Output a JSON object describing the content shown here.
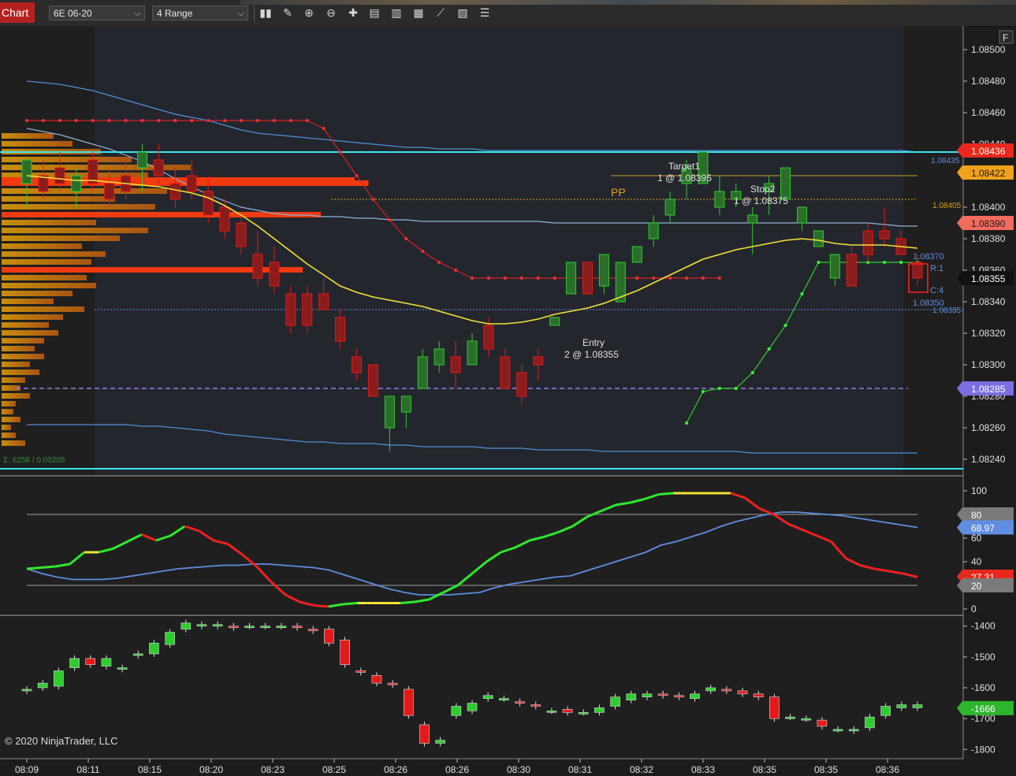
{
  "toolbar": {
    "tab_label": "Chart",
    "instrument": "6E 06-20",
    "bar_type": "4 Range",
    "icons": [
      "bar-type-icon",
      "draw-pencil-icon",
      "zoom-in-icon",
      "zoom-out-icon",
      "crosshair-icon",
      "properties-icon",
      "chart-trader-icon",
      "indicators-icon",
      "strategies-icon",
      "data-box-icon",
      "object-list-icon"
    ]
  },
  "price_panel": {
    "y_ticks": [
      "1.08500",
      "1.08480",
      "1.08460",
      "1.08440",
      "1.08420",
      "1.08400",
      "1.08380",
      "1.08360",
      "1.08340",
      "1.08320",
      "1.08300",
      "1.08280",
      "1.08260",
      "1.08240"
    ],
    "flags": [
      {
        "text": "1.08436",
        "bg": "#e8281c",
        "fg": "#ffffff"
      },
      {
        "text": "1.08422",
        "bg": "#f0a21c",
        "fg": "#1a1a1a"
      },
      {
        "text": "1.08390",
        "bg": "#f26b5e",
        "fg": "#1a1a1a"
      },
      {
        "text": "1.08355",
        "bg": "#111111",
        "fg": "#ffffff"
      },
      {
        "text": "1.08285",
        "bg": "#7b6fe0",
        "fg": "#ffffff"
      }
    ],
    "line_labels": {
      "cyan_level": "1.08435",
      "pp_level": "1.08405",
      "orders_upper": "1.08370",
      "orders_lower": "1.08350",
      "blue_level": "1.08335"
    },
    "pp_label": "PP",
    "orders": {
      "r": "R:1",
      "c": "C:4"
    },
    "annotations": {
      "target_title": "Target1",
      "target_detail": "1 @ 1.08395",
      "stop_title": "Stop2",
      "stop_detail": "1 @ 1.08375",
      "entry_title": "Entry",
      "entry_detail": "2 @ 1.08355"
    },
    "profile_summary": "Σ: 6258 / 0.00205",
    "f_button": "F"
  },
  "oscillator_panel": {
    "y_ticks": [
      "100",
      "80",
      "60",
      "40",
      "20",
      "0"
    ],
    "flags": [
      {
        "text": "80",
        "bg": "#7a7a7a",
        "fg": "#ffffff"
      },
      {
        "text": "68.97",
        "bg": "#5f8de0",
        "fg": "#ffffff"
      },
      {
        "text": "27.31",
        "bg": "#e8281c",
        "fg": "#ffffff"
      },
      {
        "text": "20",
        "bg": "#7a7a7a",
        "fg": "#ffffff"
      }
    ]
  },
  "delta_panel": {
    "y_ticks": [
      "-1400",
      "-1500",
      "-1600",
      "-1700",
      "-1800"
    ],
    "flags": [
      {
        "text": "-1666",
        "bg": "#2db52d",
        "fg": "#ffffff"
      }
    ]
  },
  "x_axis": {
    "ticks": [
      "08:09",
      "08:11",
      "08:15",
      "08:20",
      "08:23",
      "08:25",
      "08:26",
      "08:26",
      "08:30",
      "08:31",
      "08:32",
      "08:33",
      "08:35",
      "08:35",
      "08:36"
    ]
  },
  "copyright": "© 2020 NinjaTrader, LLC",
  "colors": {
    "up": "#2ecc2e",
    "down": "#e31a1a",
    "up_bright": "#19ff19",
    "down_bright": "#ff1a1a",
    "cyan": "#39e6f2",
    "pp": "#d9a21b",
    "poc": "#f03a10",
    "panel_bg": "#1e1e1e"
  },
  "chart_data": {
    "type": "candlestick",
    "price": {
      "candles": [
        {
          "o": 1.08415,
          "h": 1.08425,
          "l": 1.084,
          "c": 1.0843
        },
        {
          "o": 1.0842,
          "h": 1.0843,
          "l": 1.08405,
          "c": 1.0841
        },
        {
          "o": 1.08425,
          "h": 1.08435,
          "l": 1.0841,
          "c": 1.08415
        },
        {
          "o": 1.0841,
          "h": 1.08425,
          "l": 1.084,
          "c": 1.0842
        },
        {
          "o": 1.0843,
          "h": 1.08435,
          "l": 1.0841,
          "c": 1.08415
        },
        {
          "o": 1.08415,
          "h": 1.08425,
          "l": 1.084,
          "c": 1.08405
        },
        {
          "o": 1.0842,
          "h": 1.0843,
          "l": 1.08405,
          "c": 1.0841
        },
        {
          "o": 1.08425,
          "h": 1.0844,
          "l": 1.0841,
          "c": 1.08435
        },
        {
          "o": 1.0843,
          "h": 1.0844,
          "l": 1.08415,
          "c": 1.0842
        },
        {
          "o": 1.08415,
          "h": 1.08425,
          "l": 1.084,
          "c": 1.08405
        },
        {
          "o": 1.0842,
          "h": 1.0843,
          "l": 1.08405,
          "c": 1.0841
        },
        {
          "o": 1.0841,
          "h": 1.0842,
          "l": 1.0839,
          "c": 1.08395
        },
        {
          "o": 1.084,
          "h": 1.08405,
          "l": 1.0838,
          "c": 1.08385
        },
        {
          "o": 1.0839,
          "h": 1.08395,
          "l": 1.0837,
          "c": 1.08375
        },
        {
          "o": 1.0837,
          "h": 1.08385,
          "l": 1.0835,
          "c": 1.08355
        },
        {
          "o": 1.08365,
          "h": 1.08375,
          "l": 1.08345,
          "c": 1.0835
        },
        {
          "o": 1.08345,
          "h": 1.0835,
          "l": 1.0832,
          "c": 1.08325
        },
        {
          "o": 1.08345,
          "h": 1.0835,
          "l": 1.0832,
          "c": 1.08325
        },
        {
          "o": 1.08345,
          "h": 1.08355,
          "l": 1.08335,
          "c": 1.08335
        },
        {
          "o": 1.0833,
          "h": 1.08335,
          "l": 1.0831,
          "c": 1.08315
        },
        {
          "o": 1.08305,
          "h": 1.0831,
          "l": 1.0829,
          "c": 1.08295
        },
        {
          "o": 1.083,
          "h": 1.083,
          "l": 1.0828,
          "c": 1.0828
        },
        {
          "o": 1.0826,
          "h": 1.08265,
          "l": 1.08245,
          "c": 1.0828
        },
        {
          "o": 1.0827,
          "h": 1.08275,
          "l": 1.0826,
          "c": 1.0828
        },
        {
          "o": 1.08285,
          "h": 1.0831,
          "l": 1.08285,
          "c": 1.08305
        },
        {
          "o": 1.083,
          "h": 1.08315,
          "l": 1.08295,
          "c": 1.0831
        },
        {
          "o": 1.08305,
          "h": 1.08315,
          "l": 1.08285,
          "c": 1.08295
        },
        {
          "o": 1.083,
          "h": 1.0832,
          "l": 1.083,
          "c": 1.08315
        },
        {
          "o": 1.08325,
          "h": 1.0833,
          "l": 1.08305,
          "c": 1.0831
        },
        {
          "o": 1.08305,
          "h": 1.0831,
          "l": 1.08285,
          "c": 1.08285
        },
        {
          "o": 1.08295,
          "h": 1.083,
          "l": 1.08275,
          "c": 1.0828
        },
        {
          "o": 1.08305,
          "h": 1.0831,
          "l": 1.0829,
          "c": 1.083
        },
        {
          "o": 1.08325,
          "h": 1.0833,
          "l": 1.08325,
          "c": 1.0833
        },
        {
          "o": 1.08345,
          "h": 1.08365,
          "l": 1.08345,
          "c": 1.08365
        },
        {
          "o": 1.08365,
          "h": 1.08365,
          "l": 1.08345,
          "c": 1.08345
        },
        {
          "o": 1.0835,
          "h": 1.0837,
          "l": 1.08345,
          "c": 1.0837
        },
        {
          "o": 1.0834,
          "h": 1.08365,
          "l": 1.0834,
          "c": 1.08365
        },
        {
          "o": 1.08365,
          "h": 1.08375,
          "l": 1.08365,
          "c": 1.08375
        },
        {
          "o": 1.0838,
          "h": 1.08395,
          "l": 1.08375,
          "c": 1.0839
        },
        {
          "o": 1.08395,
          "h": 1.0841,
          "l": 1.0839,
          "c": 1.08405
        },
        {
          "o": 1.08415,
          "h": 1.0843,
          "l": 1.08405,
          "c": 1.08425
        },
        {
          "o": 1.08415,
          "h": 1.08435,
          "l": 1.08415,
          "c": 1.08435
        },
        {
          "o": 1.084,
          "h": 1.0842,
          "l": 1.08395,
          "c": 1.0841
        },
        {
          "o": 1.08405,
          "h": 1.08415,
          "l": 1.084,
          "c": 1.0841
        },
        {
          "o": 1.0839,
          "h": 1.084,
          "l": 1.0837,
          "c": 1.08395
        },
        {
          "o": 1.0841,
          "h": 1.0842,
          "l": 1.08395,
          "c": 1.08415
        },
        {
          "o": 1.08405,
          "h": 1.08425,
          "l": 1.08405,
          "c": 1.08425
        },
        {
          "o": 1.0839,
          "h": 1.084,
          "l": 1.08385,
          "c": 1.084
        },
        {
          "o": 1.08375,
          "h": 1.08385,
          "l": 1.08375,
          "c": 1.08385
        },
        {
          "o": 1.08355,
          "h": 1.0837,
          "l": 1.0835,
          "c": 1.0837
        },
        {
          "o": 1.0837,
          "h": 1.08375,
          "l": 1.0835,
          "c": 1.0835
        },
        {
          "o": 1.08385,
          "h": 1.0839,
          "l": 1.08365,
          "c": 1.0837
        },
        {
          "o": 1.08385,
          "h": 1.084,
          "l": 1.08375,
          "c": 1.0838
        },
        {
          "o": 1.0838,
          "h": 1.08385,
          "l": 1.0837,
          "c": 1.0837
        },
        {
          "o": 1.08365,
          "h": 1.0837,
          "l": 1.0835,
          "c": 1.08355
        }
      ],
      "ema": [
        1.0842,
        1.08419,
        1.08418,
        1.08417,
        1.08417,
        1.08416,
        1.08415,
        1.08414,
        1.08413,
        1.08411,
        1.08409,
        1.08406,
        1.08401,
        1.08395,
        1.08388,
        1.0838,
        1.08372,
        1.08364,
        1.08357,
        1.0835,
        1.08346,
        1.08343,
        1.08341,
        1.08339,
        1.08337,
        1.08334,
        1.08331,
        1.08328,
        1.08326,
        1.08326,
        1.08327,
        1.08329,
        1.08332,
        1.08334,
        1.08336,
        1.08339,
        1.08343,
        1.08347,
        1.08352,
        1.08357,
        1.08362,
        1.08367,
        1.0837,
        1.08373,
        1.08375,
        1.08377,
        1.08379,
        1.0838,
        1.08379,
        1.08377,
        1.08376,
        1.08376,
        1.08376,
        1.08375,
        1.08374
      ],
      "band_upper": [
        1.0848,
        1.08479,
        1.08478,
        1.08476,
        1.08474,
        1.08471,
        1.08468,
        1.08465,
        1.08462,
        1.08459,
        1.08457,
        1.08455,
        1.08452,
        1.08449,
        1.08447,
        1.08446,
        1.08445,
        1.08444,
        1.08443,
        1.08442,
        1.08441,
        1.0844,
        1.08439,
        1.08438,
        1.08438,
        1.08437,
        1.08437,
        1.08437,
        1.08436,
        1.08436,
        1.08436,
        1.08436,
        1.08436,
        1.08436,
        1.08436,
        1.08436,
        1.08436,
        1.08436,
        1.08436,
        1.08436,
        1.08436,
        1.08436,
        1.08436,
        1.08436,
        1.08436,
        1.08436,
        1.08436,
        1.08436,
        1.08436,
        1.08436,
        1.08436,
        1.08436,
        1.08436,
        1.08436,
        1.08435
      ],
      "band_mid": [
        1.0845,
        1.08448,
        1.08446,
        1.08443,
        1.0844,
        1.08437,
        1.08433,
        1.08429,
        1.08424,
        1.08418,
        1.08413,
        1.08408,
        1.08404,
        1.084,
        1.08398,
        1.08396,
        1.08395,
        1.08395,
        1.08394,
        1.08394,
        1.08393,
        1.08393,
        1.08392,
        1.08392,
        1.08391,
        1.08391,
        1.08391,
        1.08391,
        1.08391,
        1.08391,
        1.08391,
        1.08391,
        1.0839,
        1.0839,
        1.0839,
        1.0839,
        1.0839,
        1.0839,
        1.0839,
        1.0839,
        1.0839,
        1.0839,
        1.0839,
        1.0839,
        1.0839,
        1.0839,
        1.0839,
        1.0839,
        1.0839,
        1.0839,
        1.0839,
        1.0839,
        1.08389,
        1.08388,
        1.08388
      ],
      "band_lower": [
        1.08262,
        1.08262,
        1.08262,
        1.08262,
        1.08262,
        1.08262,
        1.08262,
        1.08261,
        1.08261,
        1.0826,
        1.08259,
        1.08258,
        1.08256,
        1.08255,
        1.08254,
        1.08253,
        1.08252,
        1.08251,
        1.08251,
        1.0825,
        1.0825,
        1.0825,
        1.08249,
        1.08249,
        1.08248,
        1.08248,
        1.08248,
        1.08248,
        1.08247,
        1.08247,
        1.08247,
        1.08246,
        1.08246,
        1.08246,
        1.08246,
        1.08245,
        1.08245,
        1.08245,
        1.08245,
        1.08245,
        1.08245,
        1.08245,
        1.08245,
        1.08245,
        1.08244,
        1.08244,
        1.08244,
        1.08244,
        1.08244,
        1.08244,
        1.08244,
        1.08244,
        1.08244,
        1.08244,
        1.08244
      ],
      "trail_red": [
        1.08455,
        1.08455,
        1.08455,
        1.08455,
        1.08455,
        1.08455,
        1.08455,
        1.08455,
        1.08455,
        1.08455,
        1.08455,
        1.08455,
        1.08455,
        1.08455,
        1.08455,
        1.08455,
        1.08455,
        1.08455,
        1.0845,
        1.08435,
        1.0842,
        1.08405,
        1.08392,
        1.0838,
        1.08372,
        1.08365,
        1.0836,
        1.08355,
        1.08355,
        1.08355,
        1.08355,
        1.08355,
        1.08355,
        1.08355,
        1.08355,
        1.08355,
        1.08355,
        1.08355,
        1.08355,
        1.08355,
        1.08355,
        1.08355,
        1.08355
      ],
      "trail_green_start": 40,
      "trail_green": [
        1.08263,
        1.08283,
        1.08285,
        1.08285,
        1.08295,
        1.0831,
        1.08325,
        1.08345,
        1.08365,
        1.08365,
        1.08365,
        1.08365,
        1.08365,
        1.08365,
        1.08365
      ],
      "levels": {
        "cyan_top": 1.08435,
        "cyan_bottom": 1.08234,
        "pp": 1.08405,
        "orders_gold": 1.0842,
        "red_stop": 1.08422,
        "blue_dotted": 1.08335,
        "purple_dashed": 1.08285
      },
      "y_range": [
        1.0823,
        1.08515
      ]
    },
    "oscillator": {
      "fast": [
        34,
        35,
        36,
        38,
        48,
        48,
        51,
        57,
        63,
        58,
        62,
        70,
        66,
        58,
        55,
        46,
        36,
        23,
        12,
        6,
        3,
        2,
        4,
        5,
        5,
        5,
        5,
        6,
        8,
        14,
        20,
        30,
        40,
        48,
        52,
        58,
        61,
        65,
        70,
        78,
        83,
        88,
        90,
        93,
        97,
        98,
        98,
        98,
        98,
        98,
        94,
        85,
        80,
        72,
        67,
        62,
        57,
        43,
        37,
        34,
        32,
        30,
        27
      ],
      "slow": [
        34,
        30,
        27,
        25,
        25,
        25,
        26,
        28,
        30,
        32,
        34,
        35,
        36,
        37,
        37,
        38,
        38,
        37,
        36,
        35,
        33,
        29,
        25,
        21,
        17,
        14,
        12,
        12,
        12,
        13,
        14,
        18,
        21,
        23,
        25,
        27,
        28,
        32,
        36,
        40,
        44,
        48,
        54,
        57,
        61,
        65,
        70,
        74,
        77,
        80,
        82,
        82,
        81,
        80,
        79,
        77,
        75,
        73,
        71,
        69
      ]
    },
    "delta": {
      "bars": [
        {
          "o": -1610,
          "c": -1605
        },
        {
          "o": -1600,
          "c": -1585
        },
        {
          "o": -1595,
          "c": -1545
        },
        {
          "o": -1535,
          "c": -1505
        },
        {
          "o": -1505,
          "c": -1525
        },
        {
          "o": -1530,
          "c": -1505
        },
        {
          "o": -1540,
          "c": -1535
        },
        {
          "o": -1495,
          "c": -1490
        },
        {
          "o": -1490,
          "c": -1455
        },
        {
          "o": -1460,
          "c": -1420
        },
        {
          "o": -1410,
          "c": -1390
        },
        {
          "o": -1400,
          "c": -1395
        },
        {
          "o": -1400,
          "c": -1395
        },
        {
          "o": -1400,
          "c": -1405
        },
        {
          "o": -1400,
          "c": -1400
        },
        {
          "o": -1400,
          "c": -1400
        },
        {
          "o": -1400,
          "c": -1400
        },
        {
          "o": -1400,
          "c": -1405
        },
        {
          "o": -1410,
          "c": -1415
        },
        {
          "o": -1410,
          "c": -1455
        },
        {
          "o": -1445,
          "c": -1525
        },
        {
          "o": -1545,
          "c": -1550
        },
        {
          "o": -1560,
          "c": -1585
        },
        {
          "o": -1585,
          "c": -1590
        },
        {
          "o": -1605,
          "c": -1690
        },
        {
          "o": -1720,
          "c": -1780
        },
        {
          "o": -1780,
          "c": -1770
        },
        {
          "o": -1690,
          "c": -1660
        },
        {
          "o": -1675,
          "c": -1650
        },
        {
          "o": -1635,
          "c": -1625
        },
        {
          "o": -1635,
          "c": -1635
        },
        {
          "o": -1645,
          "c": -1650
        },
        {
          "o": -1655,
          "c": -1660
        },
        {
          "o": -1675,
          "c": -1675
        },
        {
          "o": -1670,
          "c": -1680
        },
        {
          "o": -1680,
          "c": -1680
        },
        {
          "o": -1680,
          "c": -1665
        },
        {
          "o": -1660,
          "c": -1630
        },
        {
          "o": -1640,
          "c": -1620
        },
        {
          "o": -1630,
          "c": -1620
        },
        {
          "o": -1620,
          "c": -1625
        },
        {
          "o": -1625,
          "c": -1630
        },
        {
          "o": -1635,
          "c": -1620
        },
        {
          "o": -1610,
          "c": -1600
        },
        {
          "o": -1605,
          "c": -1610
        },
        {
          "o": -1610,
          "c": -1620
        },
        {
          "o": -1620,
          "c": -1630
        },
        {
          "o": -1630,
          "c": -1700
        },
        {
          "o": -1695,
          "c": -1695
        },
        {
          "o": -1700,
          "c": -1700
        },
        {
          "o": -1705,
          "c": -1725
        },
        {
          "o": -1735,
          "c": -1735
        },
        {
          "o": -1740,
          "c": -1735
        },
        {
          "o": -1730,
          "c": -1695
        },
        {
          "o": -1690,
          "c": -1660
        },
        {
          "o": -1665,
          "c": -1655
        },
        {
          "o": -1665,
          "c": -1655
        }
      ],
      "y_range": [
        -1830,
        -1370
      ]
    }
  }
}
